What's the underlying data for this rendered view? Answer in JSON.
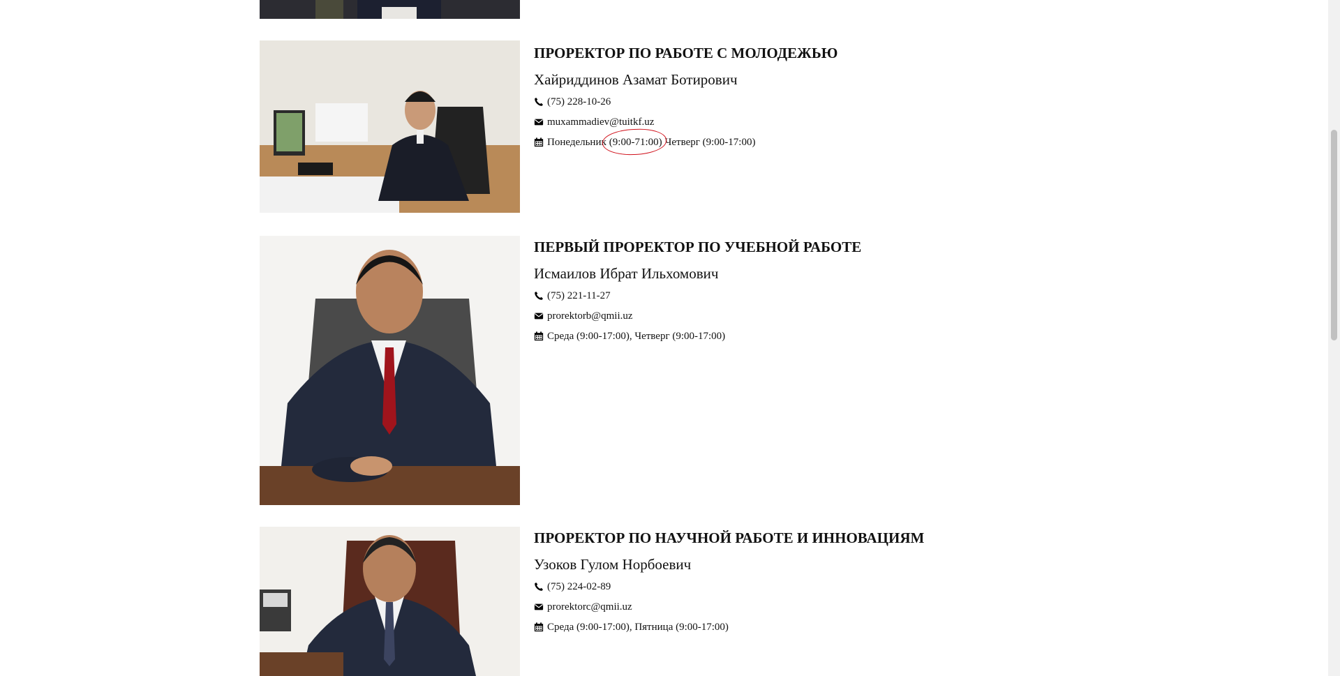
{
  "cards": [
    {
      "title": "ПРОРЕКТОР ПО РАБОТЕ С МОЛОДЕЖЬЮ",
      "name": "Хайриддинов Азамат Ботирович",
      "phone": "(75) 228-10-26",
      "email": "muxammadiev@tuitkf.uz",
      "schedule_pre": "Понедельник",
      "schedule_marked": "(9:00-71:00)",
      "schedule_post": "Четверг (9:00-17:00)"
    },
    {
      "title": "ПЕРВЫЙ ПРОРЕКТОР ПО УЧЕБНОЙ РАБОТЕ",
      "name": "Исмаилов Ибрат Ильхомович",
      "phone": "(75) 221-11-27",
      "email": "prorektorb@qmii.uz",
      "schedule": "Среда (9:00-17:00), Четверг (9:00-17:00)"
    },
    {
      "title": "ПРОРЕКТОР ПО НАУЧНОЙ РАБОТЕ И ИННОВАЦИЯМ",
      "name": "Узоков Гулом Норбоевич",
      "phone": "(75) 224-02-89",
      "email": "prorektorc@qmii.uz",
      "schedule": "Среда (9:00-17:00), Пятница (9:00-17:00)"
    }
  ],
  "icons": {
    "phone": "phone-icon",
    "email": "envelope-icon",
    "schedule": "calendar-icon"
  },
  "colors": {
    "annotation": "#d0101a",
    "text": "#111111",
    "background": "#ffffff"
  }
}
